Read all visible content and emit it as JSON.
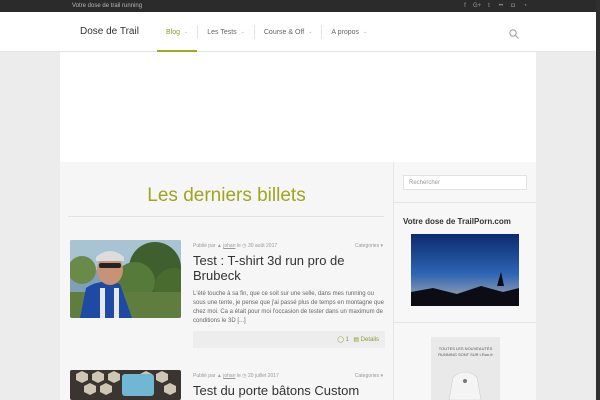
{
  "topbar": {
    "tagline": "Votre dose de trail running",
    "socials": [
      "facebook-icon",
      "google-plus-icon",
      "twitter-icon",
      "flickr-icon",
      "instagram-icon",
      "rss-icon"
    ]
  },
  "header": {
    "logo": "Dose de Trail",
    "nav": [
      {
        "label": "Blog",
        "active": true
      },
      {
        "label": "Les Tests",
        "active": false
      },
      {
        "label": "Course & Off",
        "active": false
      },
      {
        "label": "A propos",
        "active": false
      }
    ]
  },
  "main": {
    "section_title": "Les derniers billets",
    "posts": [
      {
        "meta_prefix": "Publié par",
        "author": "johan",
        "meta_mid": "le",
        "date": "30 août 2017",
        "category": "Categories",
        "title": "Test : T-shirt 3d run pro de Brubeck",
        "excerpt": "L'été touche à sa fin, que ce soit sur une selle, dans mes running ou sous une tente, je pense que j'ai passé plus de temps en montagne que chez moi. Ca a était pour moi l'occasion de tester dans un maximum de conditions le 3D [...]",
        "comments": "1",
        "details": "Details"
      },
      {
        "meta_prefix": "Publié par",
        "author": "johan",
        "meta_mid": "le",
        "date": "20 juillet 2017",
        "category": "Categories",
        "title": "Test du porte bâtons Custom"
      }
    ]
  },
  "sidebar": {
    "search_placeholder": "Rechercher",
    "widget_title": "Votre dose de TrailPorn.com",
    "ad_text": "TOUTES LES NOUVEAUTÉS RUNNING SONT SUR i-Run.fr"
  },
  "colors": {
    "accent": "#a1a41e",
    "topbar": "#2b2b2b"
  }
}
